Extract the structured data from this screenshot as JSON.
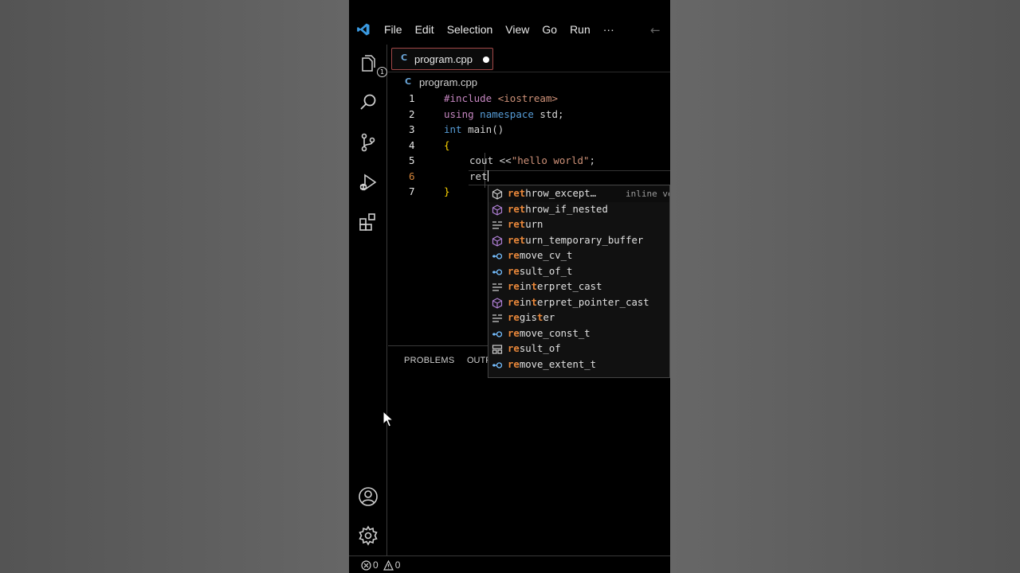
{
  "menu": {
    "items": [
      "File",
      "Edit",
      "Selection",
      "View",
      "Go",
      "Run",
      "···"
    ]
  },
  "activity_bar": {
    "explorer_badge": "1"
  },
  "tab": {
    "label": "program.cpp",
    "icon": "C",
    "modified": true
  },
  "breadcrumb": {
    "icon": "C",
    "label": "program.cpp"
  },
  "editor": {
    "lines": [
      {
        "number": "1"
      },
      {
        "number": "2"
      },
      {
        "number": "3"
      },
      {
        "number": "4"
      },
      {
        "number": "5"
      },
      {
        "number": "6"
      },
      {
        "number": "7"
      }
    ],
    "code": {
      "l1_directive": "#include",
      "l1_rest": " <iostream>",
      "l2_using": "using",
      "l2_namespace": " namespace",
      "l2_rest": " std;",
      "l3_int": "int",
      "l3_rest": " main()",
      "l4": "{",
      "l5_a": "cout <<",
      "l5_str": "\"hello world\"",
      "l5_b": ";",
      "l6": "ret",
      "l7": "}"
    }
  },
  "suggestions": [
    {
      "prefix": "ret",
      "rest": "hrow_except…",
      "kind": "cube-icon",
      "detail": "inline ve"
    },
    {
      "prefix": "ret",
      "rest": "hrow_if_nested",
      "kind": "cube-icon"
    },
    {
      "prefix": "ret",
      "rest": "urn",
      "kind": "keyword-icon"
    },
    {
      "prefix": "ret",
      "rest": "urn_temporary_buffer",
      "kind": "cube-icon"
    },
    {
      "prefix": "re",
      "rest": "move_cv_t",
      "kind": "typeparam-icon"
    },
    {
      "prefix": "re",
      "rest": "sult_of_t",
      "kind": "typeparam-icon"
    },
    {
      "prefix": "re",
      "mid1": "in",
      "mid2": "t",
      "rest": "erpret_cast",
      "kind": "keyword-icon"
    },
    {
      "prefix": "re",
      "mid1": "in",
      "mid2": "t",
      "rest": "erpret_pointer_cast",
      "kind": "cube-icon"
    },
    {
      "prefix": "re",
      "mid1": "gis",
      "mid2": "t",
      "rest": "er",
      "kind": "keyword-icon"
    },
    {
      "prefix": "re",
      "rest": "move_const_t",
      "kind": "typeparam-icon"
    },
    {
      "prefix": "re",
      "rest": "sult_of",
      "kind": "struct-icon"
    },
    {
      "prefix": "re",
      "rest": "move_extent_t",
      "kind": "typeparam-icon"
    }
  ],
  "panel": {
    "tab1": "PROBLEMS",
    "tab2": "OUTP"
  },
  "status": {
    "errors": "0",
    "warnings": "0"
  },
  "colors": {
    "accent_tab_border": "#a34848",
    "highlight": "#e8873a",
    "keyword": "#569cd6",
    "string": "#ce9178"
  }
}
